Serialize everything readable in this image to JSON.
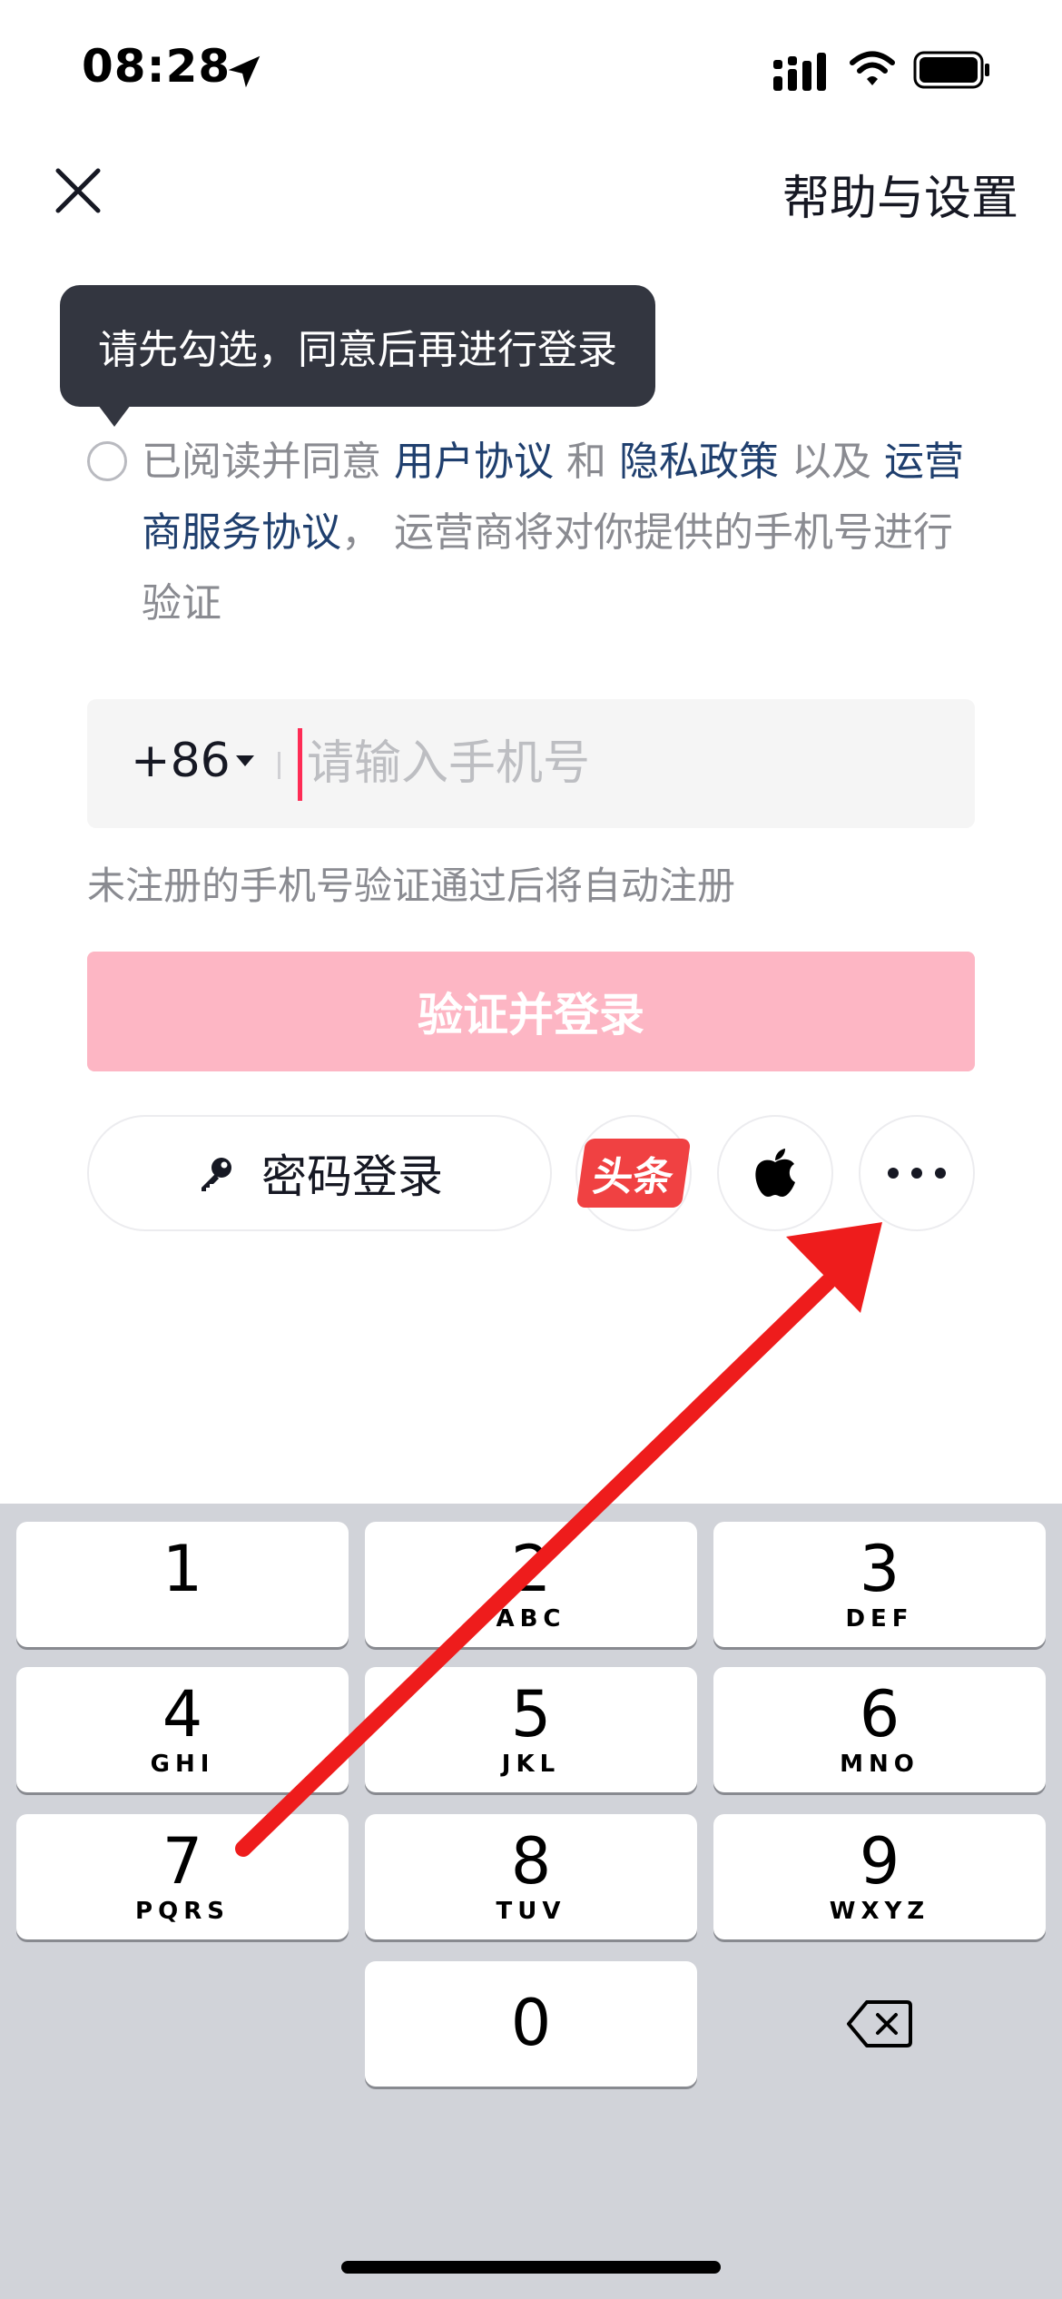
{
  "status_bar": {
    "time": "08:28"
  },
  "header": {
    "help_label": "帮助与设置"
  },
  "tooltip": {
    "text": "请先勾选，同意后再进行登录"
  },
  "agreement": {
    "prefix": "已阅读并同意 ",
    "user_agreement": "用户协议",
    "and": " 和 ",
    "privacy_policy": "隐私政策",
    "and_also": " 以及 ",
    "carrier_agreement": "运营商服务协议",
    "suffix": "， 运营商将对你提供的手机号进行验证"
  },
  "phone": {
    "country_code": "+86",
    "placeholder": "请输入手机号"
  },
  "hint": "未注册的手机号验证通过后将自动注册",
  "login_button": "验证并登录",
  "alt_login": {
    "password_label": "密码登录",
    "toutiao_label": "头条"
  },
  "keyboard": {
    "keys": [
      {
        "digit": "1",
        "letters": ""
      },
      {
        "digit": "2",
        "letters": "ABC"
      },
      {
        "digit": "3",
        "letters": "DEF"
      },
      {
        "digit": "4",
        "letters": "GHI"
      },
      {
        "digit": "5",
        "letters": "JKL"
      },
      {
        "digit": "6",
        "letters": "MNO"
      },
      {
        "digit": "7",
        "letters": "PQRS"
      },
      {
        "digit": "8",
        "letters": "TUV"
      },
      {
        "digit": "9",
        "letters": "WXYZ"
      },
      {
        "digit": "0",
        "letters": ""
      }
    ]
  },
  "colors": {
    "accent": "#fe2c55",
    "button_disabled": "#fdb6c4",
    "link": "#1f3f6e",
    "arrow": "#ee1c1c"
  }
}
